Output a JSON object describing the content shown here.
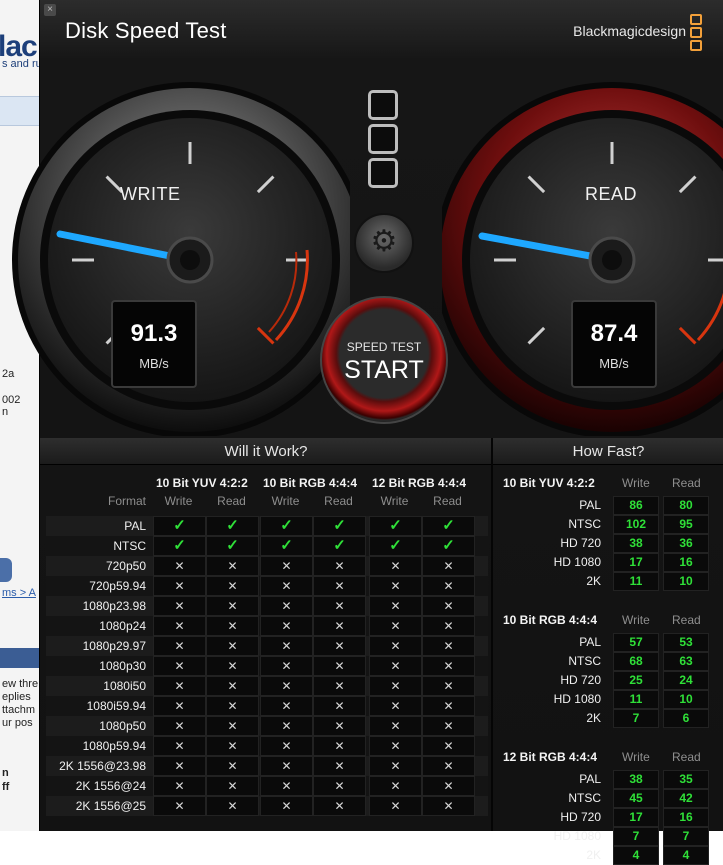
{
  "background_page": {
    "logo_fragment": "lac",
    "subtitle_fragment": "s and ru",
    "lines": [
      "2a",
      "002",
      "n",
      "ms > A",
      "ew thre",
      "eplies",
      "ttachm",
      "ur pos",
      "n",
      "ff"
    ]
  },
  "window": {
    "title": "Disk Speed Test",
    "brand": "Blackmagicdesign",
    "close_glyph": "×"
  },
  "write_gauge": {
    "label": "WRITE",
    "value": "91.3",
    "unit": "MB/s",
    "level_fraction": 0.44
  },
  "read_gauge": {
    "label": "READ",
    "value": "87.4",
    "unit": "MB/s",
    "level_fraction": 0.43
  },
  "controls": {
    "settings_icon": "gear-icon",
    "settings_glyph": "⚙",
    "start_sub": "SPEED TEST",
    "start_main": "START"
  },
  "will_it_work": {
    "title": "Will it Work?",
    "format_header": "Format",
    "groups": [
      "10 Bit YUV 4:2:2",
      "10 Bit RGB 4:4:4",
      "12 Bit RGB 4:4:4"
    ],
    "subcols": [
      "Write",
      "Read"
    ],
    "ok_glyph": "✓",
    "no_glyph": "✕",
    "rows": [
      {
        "format": "PAL",
        "ok": [
          true,
          true,
          true,
          true,
          true,
          true
        ]
      },
      {
        "format": "NTSC",
        "ok": [
          true,
          true,
          true,
          true,
          true,
          true
        ]
      },
      {
        "format": "720p50",
        "ok": [
          false,
          false,
          false,
          false,
          false,
          false
        ]
      },
      {
        "format": "720p59.94",
        "ok": [
          false,
          false,
          false,
          false,
          false,
          false
        ]
      },
      {
        "format": "1080p23.98",
        "ok": [
          false,
          false,
          false,
          false,
          false,
          false
        ]
      },
      {
        "format": "1080p24",
        "ok": [
          false,
          false,
          false,
          false,
          false,
          false
        ]
      },
      {
        "format": "1080p29.97",
        "ok": [
          false,
          false,
          false,
          false,
          false,
          false
        ]
      },
      {
        "format": "1080p30",
        "ok": [
          false,
          false,
          false,
          false,
          false,
          false
        ]
      },
      {
        "format": "1080i50",
        "ok": [
          false,
          false,
          false,
          false,
          false,
          false
        ]
      },
      {
        "format": "1080i59.94",
        "ok": [
          false,
          false,
          false,
          false,
          false,
          false
        ]
      },
      {
        "format": "1080p50",
        "ok": [
          false,
          false,
          false,
          false,
          false,
          false
        ]
      },
      {
        "format": "1080p59.94",
        "ok": [
          false,
          false,
          false,
          false,
          false,
          false
        ]
      },
      {
        "format": "2K 1556@23.98",
        "ok": [
          false,
          false,
          false,
          false,
          false,
          false
        ]
      },
      {
        "format": "2K 1556@24",
        "ok": [
          false,
          false,
          false,
          false,
          false,
          false
        ]
      },
      {
        "format": "2K 1556@25",
        "ok": [
          false,
          false,
          false,
          false,
          false,
          false
        ]
      }
    ]
  },
  "how_fast": {
    "title": "How Fast?",
    "subcols": [
      "Write",
      "Read"
    ],
    "groups": [
      {
        "name": "10 Bit YUV 4:2:2",
        "rows": [
          {
            "label": "PAL",
            "write": "86",
            "read": "80"
          },
          {
            "label": "NTSC",
            "write": "102",
            "read": "95"
          },
          {
            "label": "HD 720",
            "write": "38",
            "read": "36"
          },
          {
            "label": "HD 1080",
            "write": "17",
            "read": "16"
          },
          {
            "label": "2K",
            "write": "11",
            "read": "10"
          }
        ]
      },
      {
        "name": "10 Bit RGB 4:4:4",
        "rows": [
          {
            "label": "PAL",
            "write": "57",
            "read": "53"
          },
          {
            "label": "NTSC",
            "write": "68",
            "read": "63"
          },
          {
            "label": "HD 720",
            "write": "25",
            "read": "24"
          },
          {
            "label": "HD 1080",
            "write": "11",
            "read": "10"
          },
          {
            "label": "2K",
            "write": "7",
            "read": "6"
          }
        ]
      },
      {
        "name": "12 Bit RGB 4:4:4",
        "rows": [
          {
            "label": "PAL",
            "write": "38",
            "read": "35"
          },
          {
            "label": "NTSC",
            "write": "45",
            "read": "42"
          },
          {
            "label": "HD 720",
            "write": "17",
            "read": "16"
          },
          {
            "label": "HD 1080",
            "write": "7",
            "read": "7"
          },
          {
            "label": "2K",
            "write": "4",
            "read": "4"
          }
        ]
      }
    ]
  },
  "colors": {
    "ok_green": "#2fe038",
    "needle_blue": "#1ea8ff",
    "read_ring_red": "#9e1414",
    "brand_orange": "#f2a03a"
  }
}
